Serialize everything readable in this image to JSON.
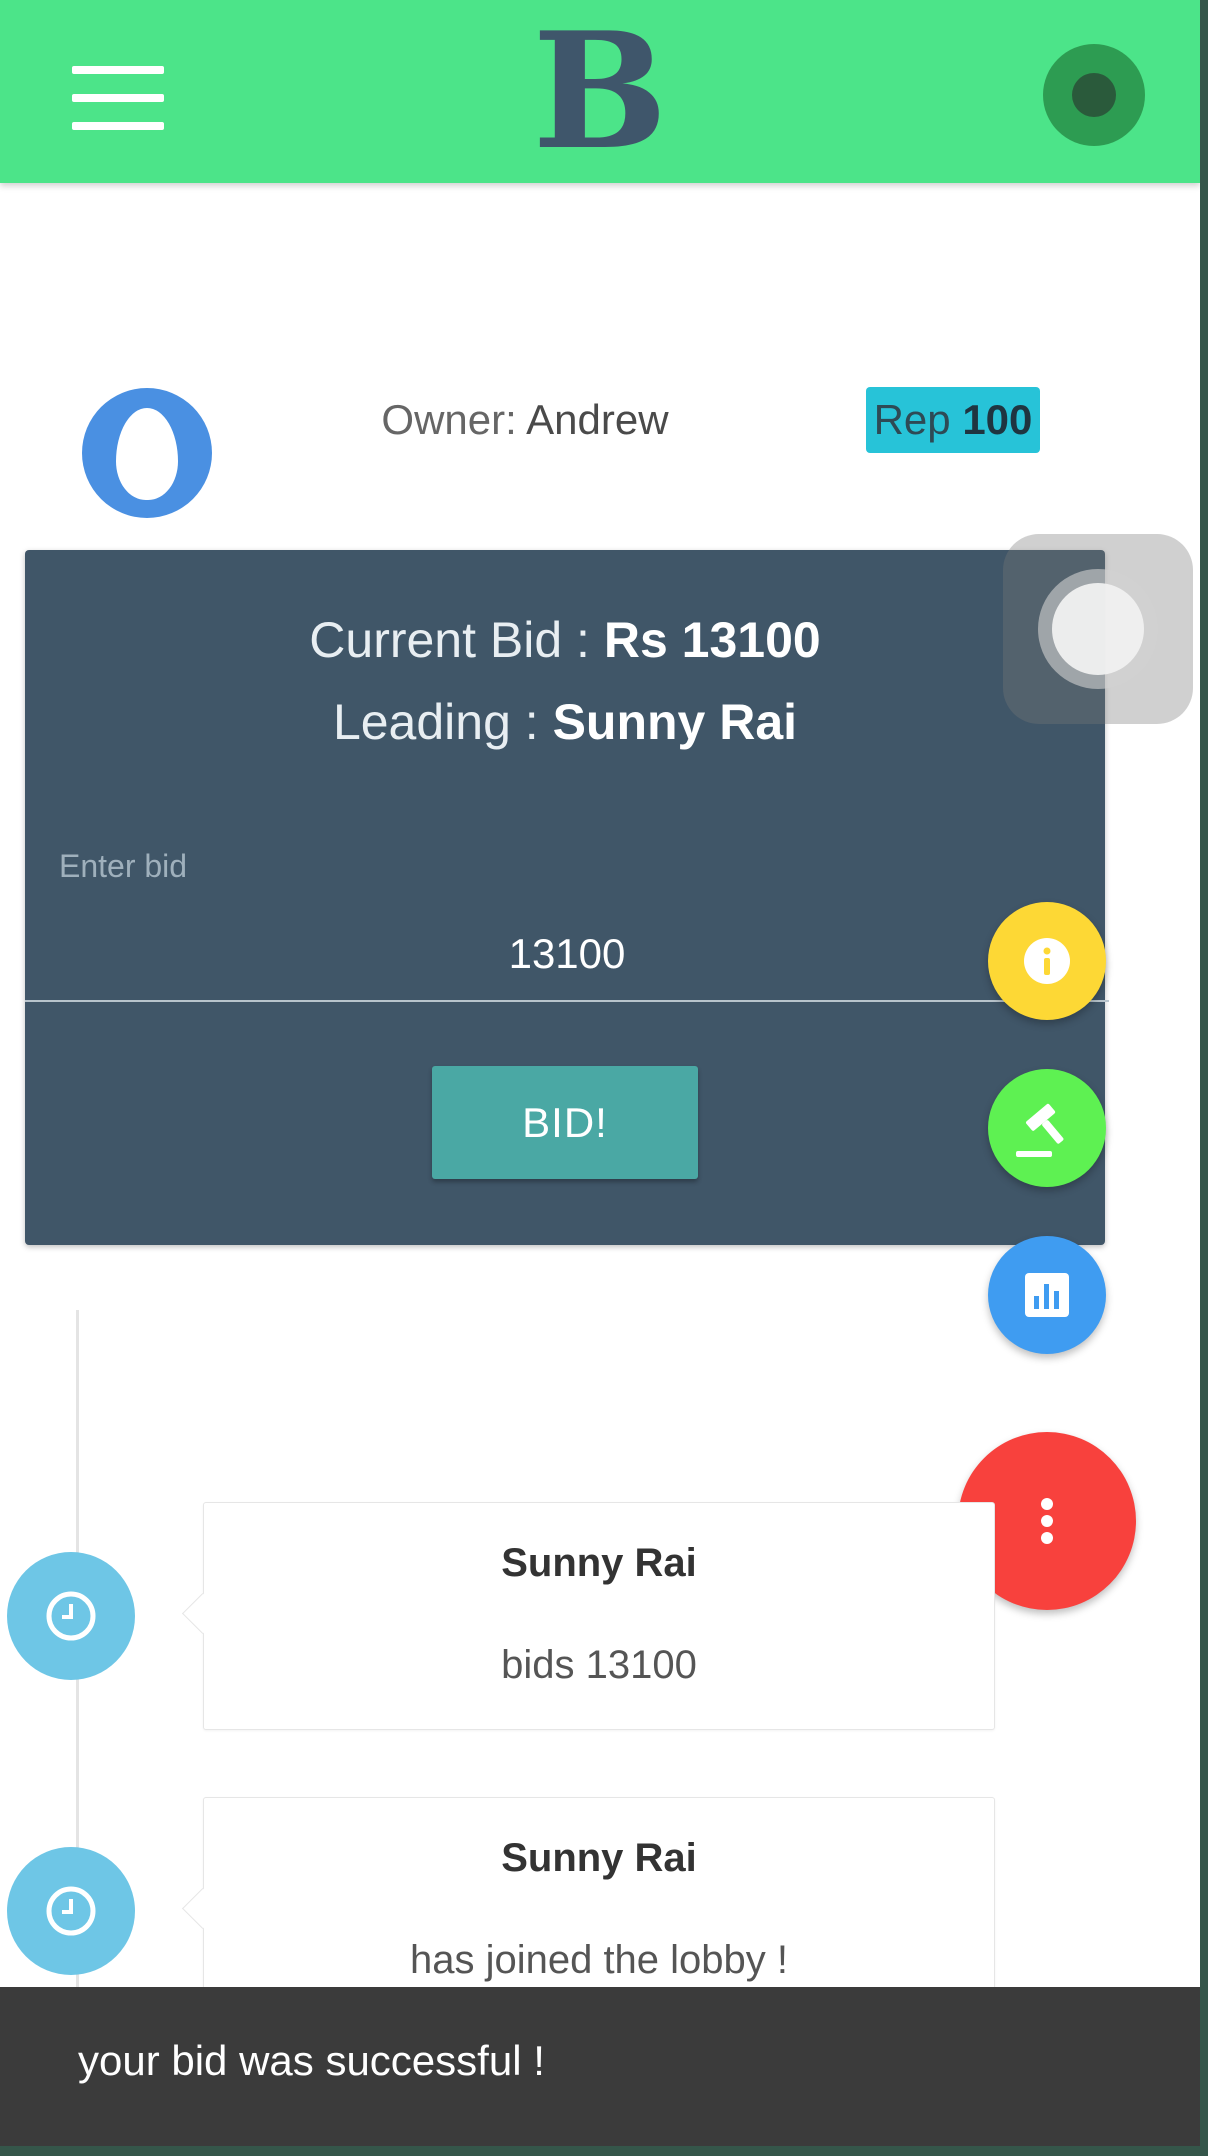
{
  "header": {
    "logo_text": "B",
    "menu_icon": "hamburger-menu-icon",
    "profile_icon": "profile-circle-icon",
    "color": "#4ce489"
  },
  "owner": {
    "label": "Owner: ",
    "name": "Andrew",
    "avatar_icon": "egg-avatar-icon",
    "rep_label": "Rep ",
    "rep_value": "100"
  },
  "bid_card": {
    "current_bid_label": "Current Bid : ",
    "current_bid_value": "Rs 13100",
    "leading_label": "Leading : ",
    "leading_value": "Sunny Rai",
    "input_label": "Enter bid",
    "input_value": "13100",
    "bid_button_label": "BID!",
    "background": "#405668",
    "button_color": "#4aa8a4"
  },
  "fabs": [
    {
      "icon": "info-icon",
      "color": "#fdd835"
    },
    {
      "icon": "gavel-icon",
      "color": "#5ef152"
    },
    {
      "icon": "bar-chart-icon",
      "color": "#3f9cf1"
    },
    {
      "icon": "more-vertical-icon",
      "color": "#f8413d"
    }
  ],
  "timeline": [
    {
      "who": "Sunny Rai",
      "what": "bids 13100",
      "icon": "clock-icon"
    },
    {
      "who": "Sunny Rai",
      "what": "has joined the lobby !",
      "icon": "clock-icon"
    }
  ],
  "snackbar": {
    "message": "your bid was successful !"
  }
}
